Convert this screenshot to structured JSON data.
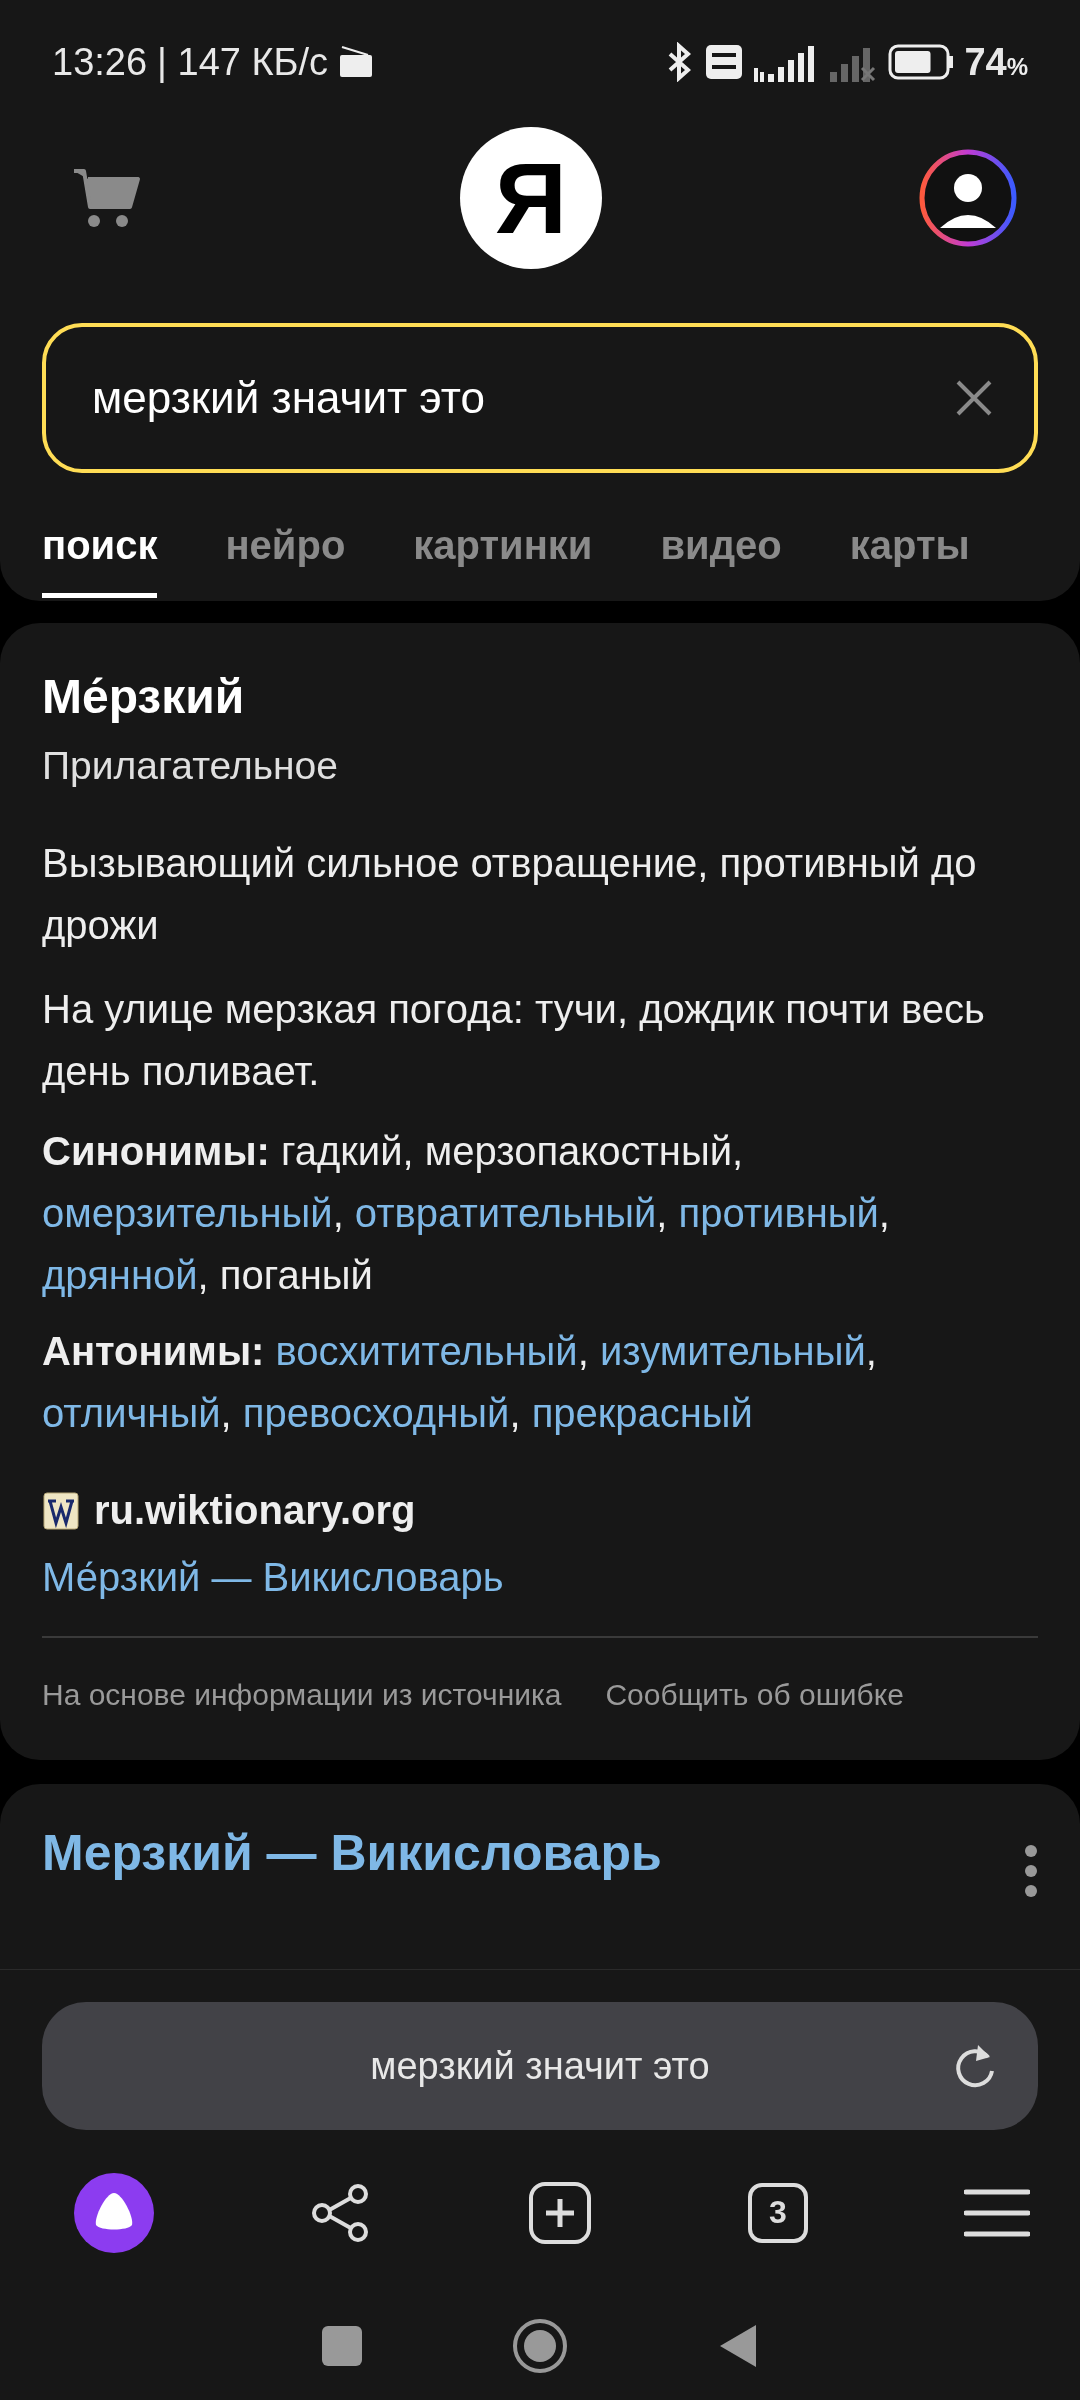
{
  "status_bar": {
    "time": "13:26",
    "speed": "| 147 КБ/с",
    "battery": "74",
    "battery_unit": "%"
  },
  "header": {
    "logo": "Я"
  },
  "search": {
    "value": "мерзкий значит это"
  },
  "tabs": [
    {
      "label": "поиск",
      "selected": true
    },
    {
      "label": "нейро",
      "selected": false
    },
    {
      "label": "картинки",
      "selected": false
    },
    {
      "label": "видео",
      "selected": false
    },
    {
      "label": "карты",
      "selected": false
    }
  ],
  "dictionary_card": {
    "word": "Ме́рзкий",
    "part_of_speech": "Прилагательное",
    "definition": "Вызывающий сильное отвращение, противный до дрожи",
    "example": "На улице мерзкая погода: тучи, дождик почти весь день поливает.",
    "synonyms_label": "Синонимы:",
    "synonyms": [
      {
        "text": "гадкий",
        "link": false,
        "separator": ","
      },
      {
        "text": "мерзопакостный",
        "link": false,
        "separator": ","
      },
      {
        "text": "омерзительный",
        "link": true,
        "separator": ","
      },
      {
        "text": "отвратительный",
        "link": true,
        "separator": ","
      },
      {
        "text": "противный",
        "link": true,
        "separator": ","
      },
      {
        "text": "дрянной",
        "link": true,
        "separator": ","
      },
      {
        "text": "поганый",
        "link": false
      }
    ],
    "antonyms_label": "Антонимы:",
    "antonyms": [
      {
        "text": "восхитительный",
        "link": true,
        "separator": ","
      },
      {
        "text": "изумительный",
        "link": true,
        "separator": ","
      },
      {
        "text": "отличный",
        "link": true,
        "separator": ","
      },
      {
        "text": "превосходный",
        "link": true,
        "separator": ","
      },
      {
        "text": "прекрасный",
        "link": true
      }
    ],
    "source_site": "ru.wiktionary.org",
    "source_title": "Ме́рзкий — Викисловарь",
    "source_note": "На основе информации из источника",
    "report": "Сообщить об ошибке"
  },
  "result_card": {
    "title": "Мерзкий — Викисловарь"
  },
  "address_bar": {
    "text": "мерзкий значит это"
  },
  "toolbar": {
    "tab_count": "3"
  }
}
